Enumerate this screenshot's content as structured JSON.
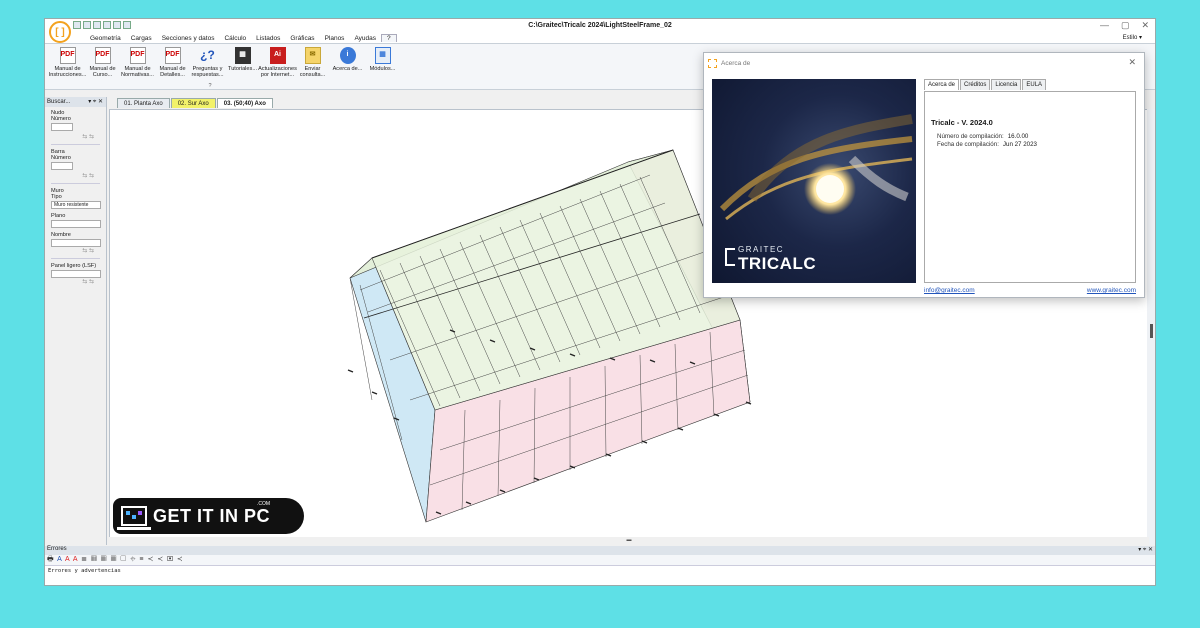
{
  "window": {
    "title": "C:\\Graitec\\Tricalc 2024\\LightSteelFrame_02",
    "controls": [
      "—",
      "▢",
      "✕"
    ]
  },
  "menu": {
    "items": [
      "Geometría",
      "Cargas",
      "Secciones y datos",
      "Cálculo",
      "Listados",
      "Gráficas",
      "Planos",
      "Ayudas",
      "?"
    ],
    "estilo": "Estilo ▾"
  },
  "ribbon": {
    "buttons": [
      {
        "label": "Manual de Instrucciones...",
        "icon": "pdf-icon",
        "glyph": "PDF"
      },
      {
        "label": "Manual de Curso...",
        "icon": "pdf-icon",
        "glyph": "PDF"
      },
      {
        "label": "Manual de Normativas...",
        "icon": "pdf-icon",
        "glyph": "PDF"
      },
      {
        "label": "Manual de Detalles...",
        "icon": "pdf-icon",
        "glyph": "PDF"
      },
      {
        "label": "Preguntas y respuestas...",
        "icon": "question-icon",
        "glyph": "¿?"
      },
      {
        "label": "Tutoriales...",
        "icon": "film-icon",
        "glyph": "▦"
      },
      {
        "label": "Actualizaciones por Internet...",
        "icon": "update-icon",
        "glyph": "Ai"
      },
      {
        "label": "Enviar consulta...",
        "icon": "mail-icon",
        "glyph": "✉"
      },
      {
        "label": "Acerca de...",
        "icon": "info-icon",
        "glyph": "i"
      },
      {
        "label": "Módulos...",
        "icon": "modules-icon",
        "glyph": "▦"
      }
    ],
    "group_title": "?"
  },
  "sidebar": {
    "header": "Buscar...",
    "header_tools": "▾ ⌖ ✕",
    "nudo_title": "Nudo",
    "nudo_label": "Número",
    "barra_title": "Barra",
    "barra_label": "Número",
    "muro_title": "Muro",
    "tipo_label": "Tipo",
    "tipo_value": "Muro resistente",
    "plano_label": "Plano",
    "nombre_label": "Nombre",
    "panel_label": "Panel ligero (LSF)",
    "tool_glyphs": "⇆ ⇆"
  },
  "doc_tabs": [
    {
      "label": "01. Planta Axo",
      "style": "normal"
    },
    {
      "label": "02. Sur Axo",
      "style": "yellow"
    },
    {
      "label": "03. (50;40) Axo",
      "style": "active"
    }
  ],
  "errors_panel": {
    "title": "Errores",
    "header_tools": "▾ ⌖ ✕",
    "row": "Errores y advertencias",
    "tools": [
      "🖶",
      "A",
      "A",
      "A",
      "≣",
      "▦",
      "▦",
      "▦",
      "▢",
      "⌖",
      "≡",
      "≺",
      "≺",
      "▣",
      "≺"
    ]
  },
  "about_dialog": {
    "title": "Acerca de",
    "tabs": [
      "Acerca de",
      "Créditos",
      "Licencia",
      "EULA"
    ],
    "version": "Tricalc - V. 2024.0",
    "build_label": "Número de compilación:",
    "build_value": "16.0.00",
    "date_label": "Fecha de compilación:",
    "date_value": "Jun 27 2023",
    "email": "info@graitec.com",
    "website": "www.graitec.com",
    "brand_small": "GRAITEC",
    "brand_large": "TRICALC"
  },
  "watermark": {
    "text": "GET IT IN PC",
    "suffix": ".COM"
  },
  "colors": {
    "background": "#5ee0e6",
    "accent_orange": "#f3a21e",
    "link_blue": "#2255bb",
    "pdf_red": "#c00000"
  }
}
